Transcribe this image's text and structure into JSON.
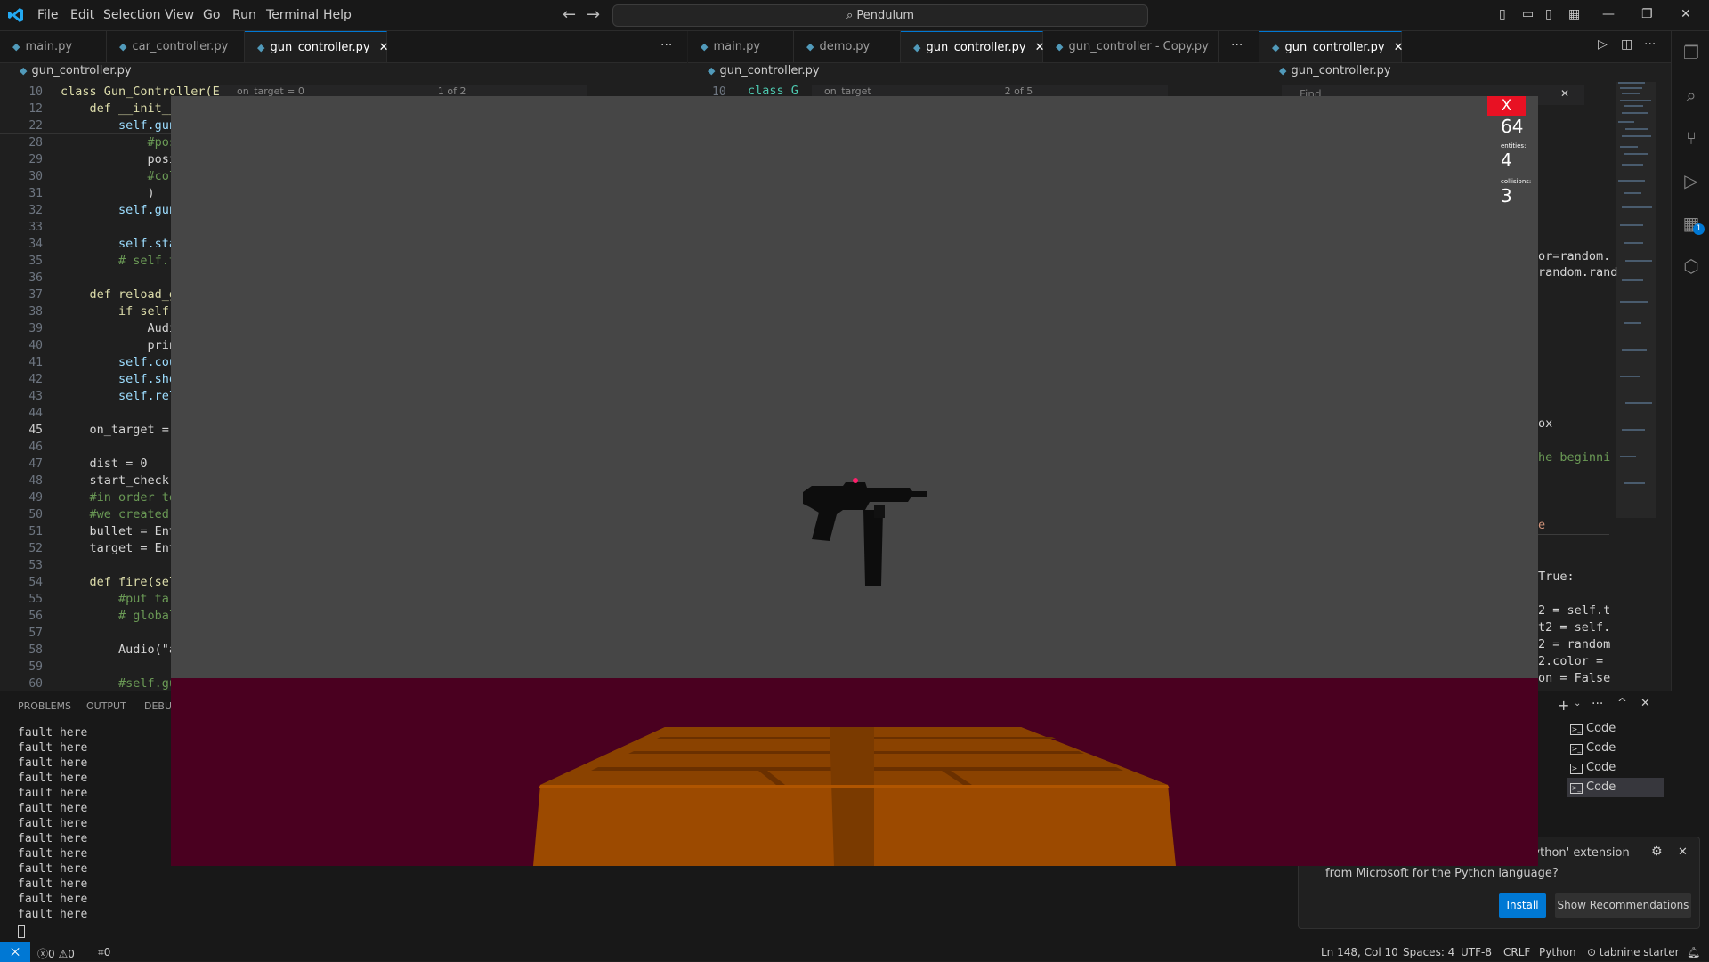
{
  "titlebar": {
    "menus": [
      "File",
      "Edit",
      "Selection",
      "View",
      "Go",
      "Run",
      "Terminal",
      "Help"
    ],
    "search": "Pendulum",
    "colors": {
      "accent": "#0078d4"
    }
  },
  "editor_groups": [
    {
      "tabs": [
        {
          "label": "main.py",
          "active": false
        },
        {
          "label": "car_controller.py",
          "active": false
        },
        {
          "label": "gun_controller.py",
          "active": true
        }
      ],
      "breadcrumb": "gun_controller.py",
      "find": "on_target = 0",
      "find_count": "1 of 2"
    },
    {
      "tabs": [
        {
          "label": "main.py",
          "active": false
        },
        {
          "label": "demo.py",
          "active": false
        },
        {
          "label": "gun_controller.py",
          "active": true
        },
        {
          "label": "gun_controller - Copy.py",
          "active": false
        }
      ],
      "breadcrumb": "gun_controller.py",
      "find": "on_target",
      "find_count": "2 of 5"
    },
    {
      "tabs": [
        {
          "label": "gun_controller.py",
          "active": true
        }
      ],
      "breadcrumb": "gun_controller.py",
      "find_placeholder": "Find"
    }
  ],
  "code": {
    "line_numbers": [
      "10",
      "12",
      "22",
      "28",
      "29",
      "30",
      "31",
      "32",
      "33",
      "34",
      "35",
      "36",
      "37",
      "38",
      "39",
      "40",
      "41",
      "42",
      "43",
      "44",
      "45",
      "46",
      "47",
      "48",
      "49",
      "50",
      "51",
      "52",
      "53",
      "54",
      "55",
      "56",
      "57",
      "58",
      "59",
      "60"
    ],
    "lines": [
      "class Gun_Controller(E",
      "    def __init__",
      "        self.gun",
      "            #pos",
      "            posi",
      "            #col",
      "            )",
      "        self.gun",
      "",
      "        self.sta",
      "        # self.t",
      "",
      "    def reload_g",
      "        if self.",
      "            Audi",
      "            prin",
      "        self.cou",
      "        self.sho",
      "        self.rel",
      "",
      "    on_target = ",
      "",
      "    dist = 0",
      "    start_check",
      "    #in order to",
      "    #we created",
      "    bullet = Ent",
      "    target = Ent",
      "",
      "    def fire(sel",
      "        #put tar",
      "        # global",
      "",
      "        Audio(\"a",
      "",
      "        #self.gu"
    ],
    "right_fragments": [
      "or=random.",
      "random.rand",
      "ox",
      "he beginni",
      "e",
      "True:",
      "2 = self.t",
      "t2 = self.",
      "2 = random",
      "2.color =",
      "on = False"
    ],
    "group2_fragment": "class G"
  },
  "game_window": {
    "close_label": "X",
    "fps": "64",
    "entities_label": "entities:",
    "entities": "4",
    "collisions_label": "collisions:",
    "collisions": "3",
    "crosshair_color": "#ff1f6b",
    "sky_color": "#464646",
    "floor_color": "#4a0020",
    "box_color": "#9c4a00"
  },
  "panel": {
    "tabs": [
      "PROBLEMS",
      "OUTPUT",
      "DEBU"
    ],
    "output_lines": [
      "fault here",
      "fault here",
      "fault here",
      "fault here",
      "fault here",
      "fault here",
      "fault here",
      "fault here",
      "fault here",
      "fault here",
      "fault here",
      "fault here",
      "fault here"
    ],
    "terminals": [
      {
        "label": "Code",
        "selected": false
      },
      {
        "label": "Code",
        "selected": false
      },
      {
        "label": "Code",
        "selected": false
      },
      {
        "label": "Code",
        "selected": true
      }
    ]
  },
  "toast": {
    "title": "'Python' extension",
    "message": "from Microsoft for the Python language?",
    "install": "Install",
    "recommend": "Show Recommendations"
  },
  "statusbar": {
    "errors": "0",
    "warnings": "0",
    "ports": "0",
    "position": "Ln 148, Col 10",
    "spaces": "Spaces: 4",
    "encoding": "UTF-8",
    "eol": "CRLF",
    "language": "Python",
    "tabnine": "tabnine starter"
  },
  "activity": {
    "badge": "1"
  }
}
